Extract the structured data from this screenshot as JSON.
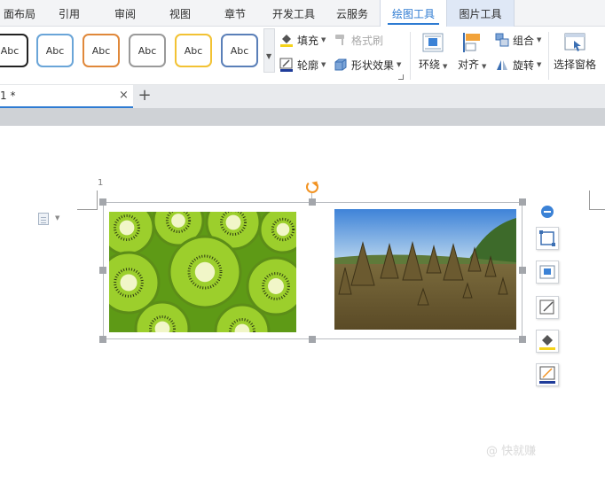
{
  "menu_tabs": [
    {
      "label": "面布局"
    },
    {
      "label": "引用"
    },
    {
      "label": "审阅"
    },
    {
      "label": "视图"
    },
    {
      "label": "章节"
    },
    {
      "label": "开发工具"
    },
    {
      "label": "云服务"
    },
    {
      "label": "绘图工具"
    },
    {
      "label": "图片工具"
    }
  ],
  "ribbon": {
    "shape_style_label": "Abc",
    "fill_label": "填充",
    "format_painter_label": "格式刷",
    "outline_label": "轮廓",
    "shape_effects_label": "形状效果",
    "wrap_label": "环绕",
    "align_label": "对齐",
    "group_label": "组合",
    "rotate_label": "旋转",
    "selection_pane_label": "选择窗格"
  },
  "doc_tab": {
    "name": "1 *",
    "close": "×",
    "new_tab": "+"
  },
  "page": {
    "page_number": "1"
  },
  "watermark": "@ 快就赚",
  "colors": {
    "accent": "#2e7bd2",
    "rotate_handle": "#f29322",
    "style_borders": [
      "#222222",
      "#6aa5d8",
      "#e0883a",
      "#9a9a9a",
      "#f2c233",
      "#5a7fb8"
    ]
  },
  "icons": [
    "fill-bucket-icon",
    "format-painter-icon",
    "outline-pen-icon",
    "shape-effects-icon",
    "wrap-icon",
    "align-icon",
    "group-icon",
    "rotate-icon",
    "selection-pane-icon",
    "document-icon",
    "collapse-icon",
    "crop-icon",
    "layout-icon",
    "edit-shape-icon",
    "fill-icon",
    "outline-icon"
  ]
}
